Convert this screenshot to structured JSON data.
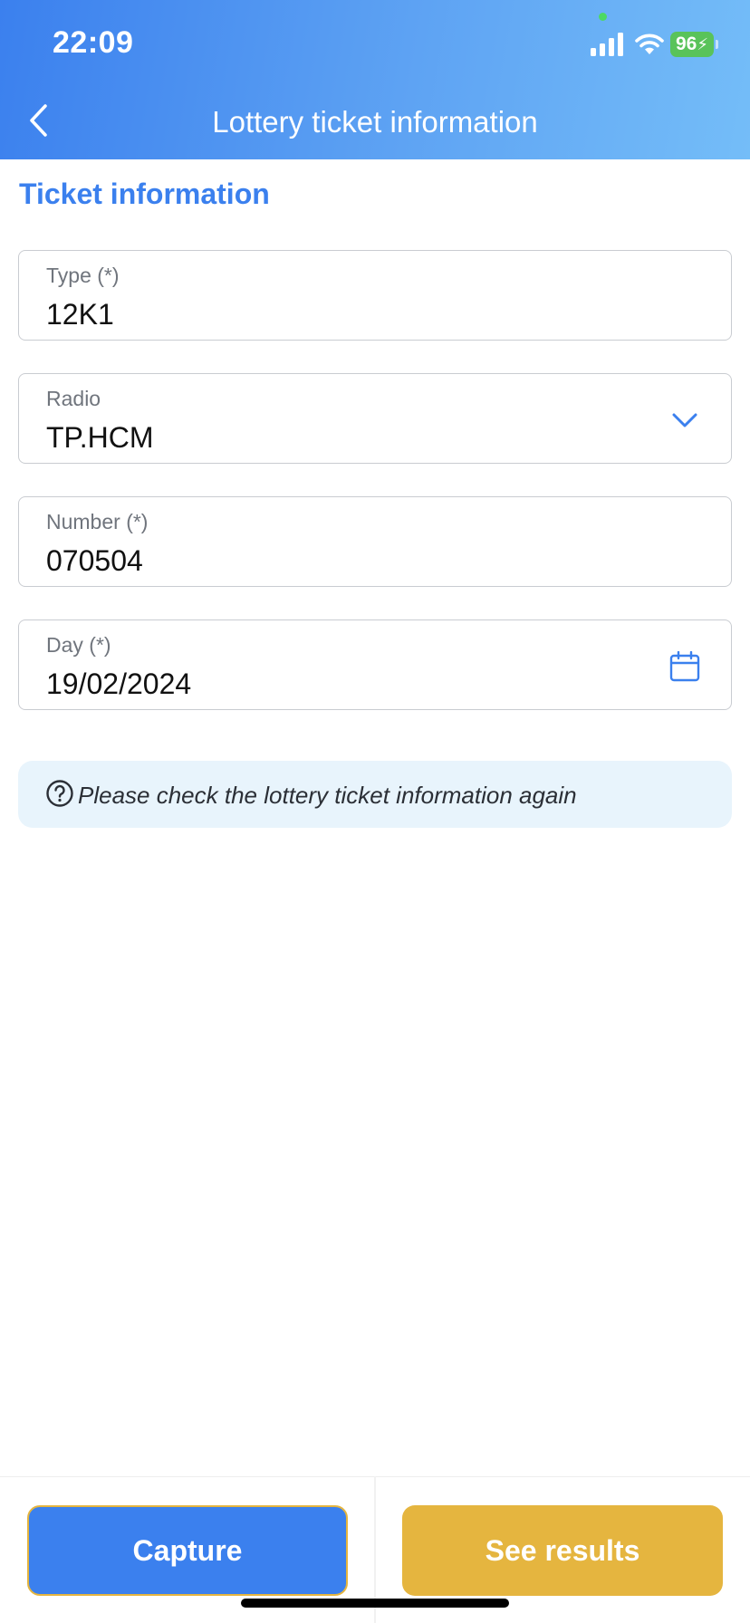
{
  "status_bar": {
    "time": "22:09",
    "battery_level": "96",
    "icons": [
      "signal-icon",
      "wifi-icon",
      "battery-charging-icon"
    ]
  },
  "header": {
    "title": "Lottery ticket information",
    "back_icon": "chevron-left-icon"
  },
  "section": {
    "title": "Ticket information"
  },
  "fields": {
    "type": {
      "label": "Type (*)",
      "value": "12K1"
    },
    "radio": {
      "label": "Radio",
      "value": "TP.HCM",
      "icon": "chevron-down-icon"
    },
    "number": {
      "label": "Number (*)",
      "value": "070504"
    },
    "day": {
      "label": "Day (*)",
      "value": "19/02/2024",
      "icon": "calendar-icon"
    }
  },
  "notice": {
    "icon": "question-circle-icon",
    "text": "Please check the lottery ticket information again"
  },
  "actions": {
    "capture_label": "Capture",
    "see_results_label": "See results"
  },
  "colors": {
    "primary_blue": "#3b80ee",
    "accent_gold": "#e5b53f",
    "notice_bg": "#e8f4fc"
  }
}
